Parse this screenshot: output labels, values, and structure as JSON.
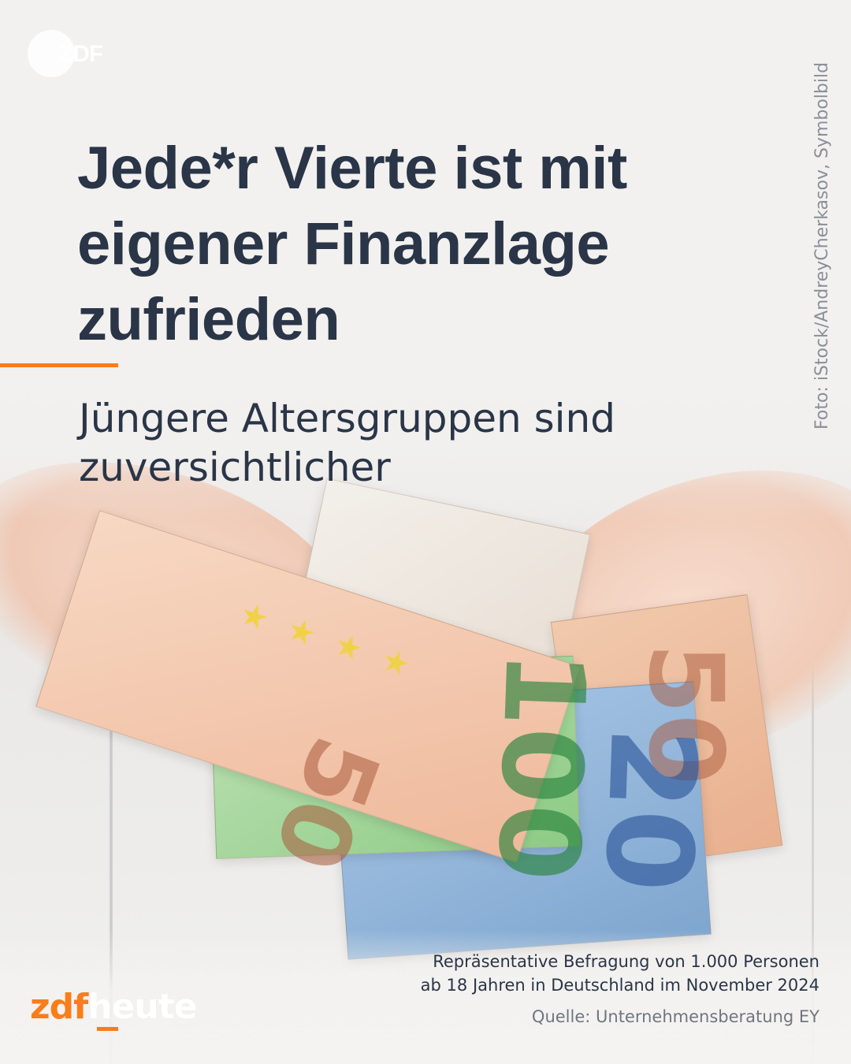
{
  "watermark": {
    "logo_text": "ZDF",
    "icon": "zdf-logo-icon"
  },
  "headline": "Jede*r Vierte ist mit eigener Finanzlage zufrieden",
  "subline": "Jüngere Altersgruppen sind zuversichtlicher",
  "photo_credit": "Foto: iStock/AndreyCherkasov, Symbolbild",
  "footer": {
    "line1": "Repräsentative Befragung von 1.000 Personen",
    "line2": "ab 18 Jahren in Deutschland im November 2024",
    "source": "Quelle: Unternehmensberatung EY"
  },
  "brand": {
    "part1": "zdf",
    "part2": "heute"
  },
  "photo": {
    "banknote_values": [
      "50",
      "100",
      "20",
      "50"
    ],
    "colors": {
      "accent": "#fa7d19",
      "text": "#2a3547",
      "credit": "#8a8f98"
    }
  }
}
